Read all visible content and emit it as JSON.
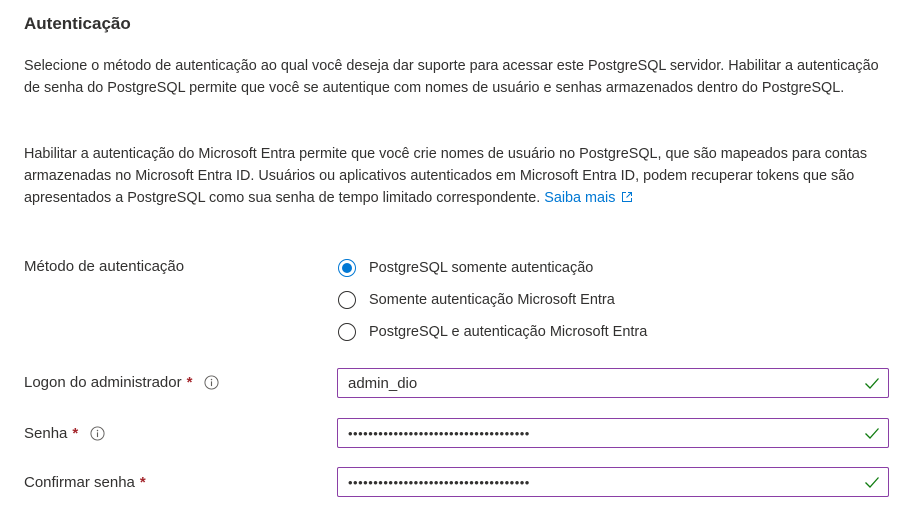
{
  "section": {
    "title": "Autenticação"
  },
  "description": {
    "paragraph1": "Selecione o método de autenticação ao qual você deseja dar suporte para acessar este PostgreSQL servidor. Habilitar a autenticação de senha do PostgreSQL permite que você se autentique com nomes de usuário e senhas armazenados dentro do PostgreSQL.",
    "paragraph2": "Habilitar a autenticação do Microsoft Entra permite que você crie nomes de usuário no PostgreSQL, que são mapeados para contas armazenadas no Microsoft Entra ID. Usuários ou aplicativos autenticados em Microsoft Entra ID, podem recuperar tokens que são apresentados a PostgreSQL como sua senha de tempo limitado correspondente.",
    "learn_more": "Saiba mais",
    "learn_more_icon": "external-link-icon"
  },
  "auth_method": {
    "label": "Método de autenticação",
    "options": [
      {
        "label": "PostgreSQL somente autenticação",
        "selected": true
      },
      {
        "label": "Somente autenticação Microsoft Entra",
        "selected": false
      },
      {
        "label": "PostgreSQL e autenticação Microsoft Entra",
        "selected": false
      }
    ]
  },
  "admin_login": {
    "label": "Logon do administrador",
    "required_mark": "*",
    "info_icon": "info-icon",
    "value": "admin_dio",
    "valid_icon": "check-icon"
  },
  "password": {
    "label": "Senha",
    "required_mark": "*",
    "info_icon": "info-icon",
    "value": "••••••••••••••••••••••••••••••••••••",
    "valid_icon": "check-icon"
  },
  "confirm_password": {
    "label": "Confirmar senha",
    "required_mark": "*",
    "value": "••••••••••••••••••••••••••••••••••••",
    "valid_icon": "check-icon"
  },
  "colors": {
    "accent": "#0078d4",
    "required": "#a4262c",
    "input_border": "#8a3fa6",
    "valid": "#107c10"
  }
}
